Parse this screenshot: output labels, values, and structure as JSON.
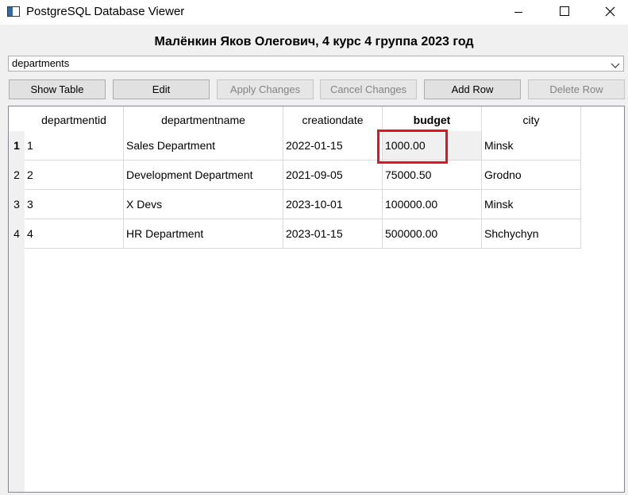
{
  "window": {
    "title": "PostgreSQL Database Viewer"
  },
  "heading": "Малёнкин Яков Олегович, 4 курс 4 группа 2023 год",
  "table_select": {
    "selected": "departments"
  },
  "toolbar": {
    "show_table": "Show Table",
    "edit": "Edit",
    "apply_changes": "Apply Changes",
    "cancel_changes": "Cancel Changes",
    "add_row": "Add Row",
    "delete_row": "Delete Row"
  },
  "grid": {
    "columns": [
      "departmentid",
      "departmentname",
      "creationdate",
      "budget",
      "city"
    ],
    "row_numbers": [
      "1",
      "2",
      "3",
      "4"
    ],
    "rows": [
      [
        "1",
        "Sales Department",
        "2022-01-15",
        "1000.00",
        "Minsk"
      ],
      [
        "2",
        "Development Department",
        "2021-09-05",
        "75000.50",
        "Grodno"
      ],
      [
        "3",
        "X Devs",
        "2023-10-01",
        "100000.00",
        "Minsk"
      ],
      [
        "4",
        "HR Department",
        "2023-01-15",
        "500000.00",
        "Shchychyn"
      ]
    ]
  },
  "colors": {
    "highlight": "#e81123"
  }
}
